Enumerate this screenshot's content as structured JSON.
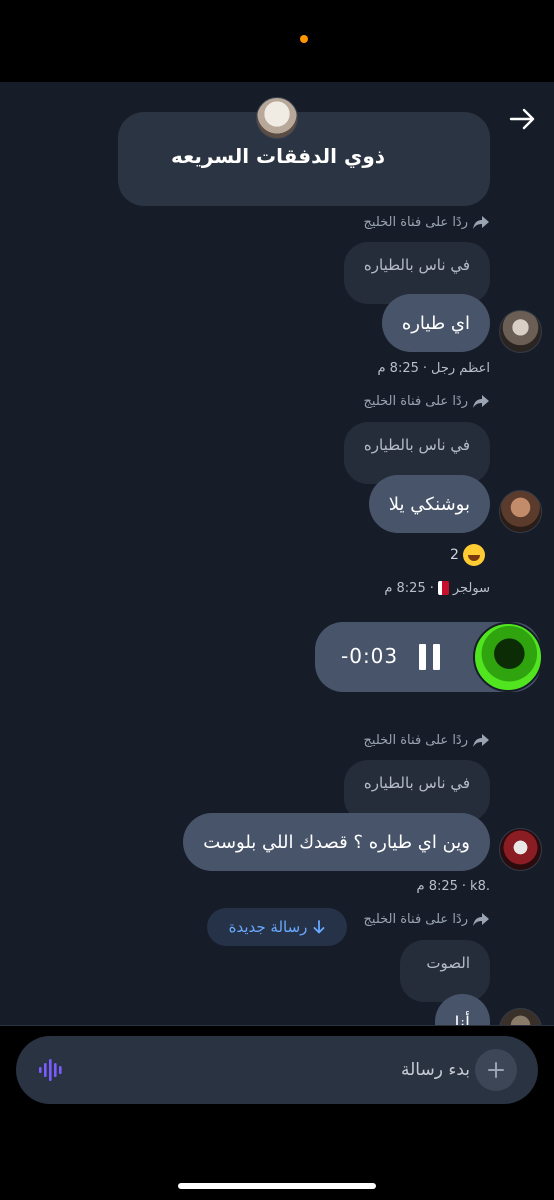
{
  "header": {
    "title": "ذوي الدفقات السريعه"
  },
  "messages": [
    {
      "reply_to": "ردًا على فناة الخليج",
      "quoted_text": "في ناس بالطياره",
      "text": "اي طياره",
      "sender": "اعظم رجل",
      "time": "8:25 م"
    },
    {
      "reply_to": "ردًا على فناة الخليج",
      "quoted_text": "في ناس بالطياره",
      "text": "بوشنكي يلا",
      "reaction_count": "2",
      "sender": "سولجر",
      "time": "8:25 م"
    },
    {
      "type": "voice",
      "duration": "-0:03"
    },
    {
      "reply_to": "ردًا على فناة الخليج",
      "quoted_text": "في ناس بالطياره",
      "text": "وين اي طياره ؟ قصدك اللي بلوست",
      "sender": ".k8",
      "time": "8:25 م"
    },
    {
      "reply_to": "ردًا على فناة الخليج",
      "quoted_text": "الصوت",
      "text": "أنا"
    }
  ],
  "new_message_button": "رسالة جديدة",
  "composer": {
    "placeholder": "بدء رسالة"
  },
  "colors": {
    "background": "#161d28",
    "bubble": "#48546a",
    "accent": "#6aa9ff",
    "voice_icon": "#7b5cff"
  }
}
